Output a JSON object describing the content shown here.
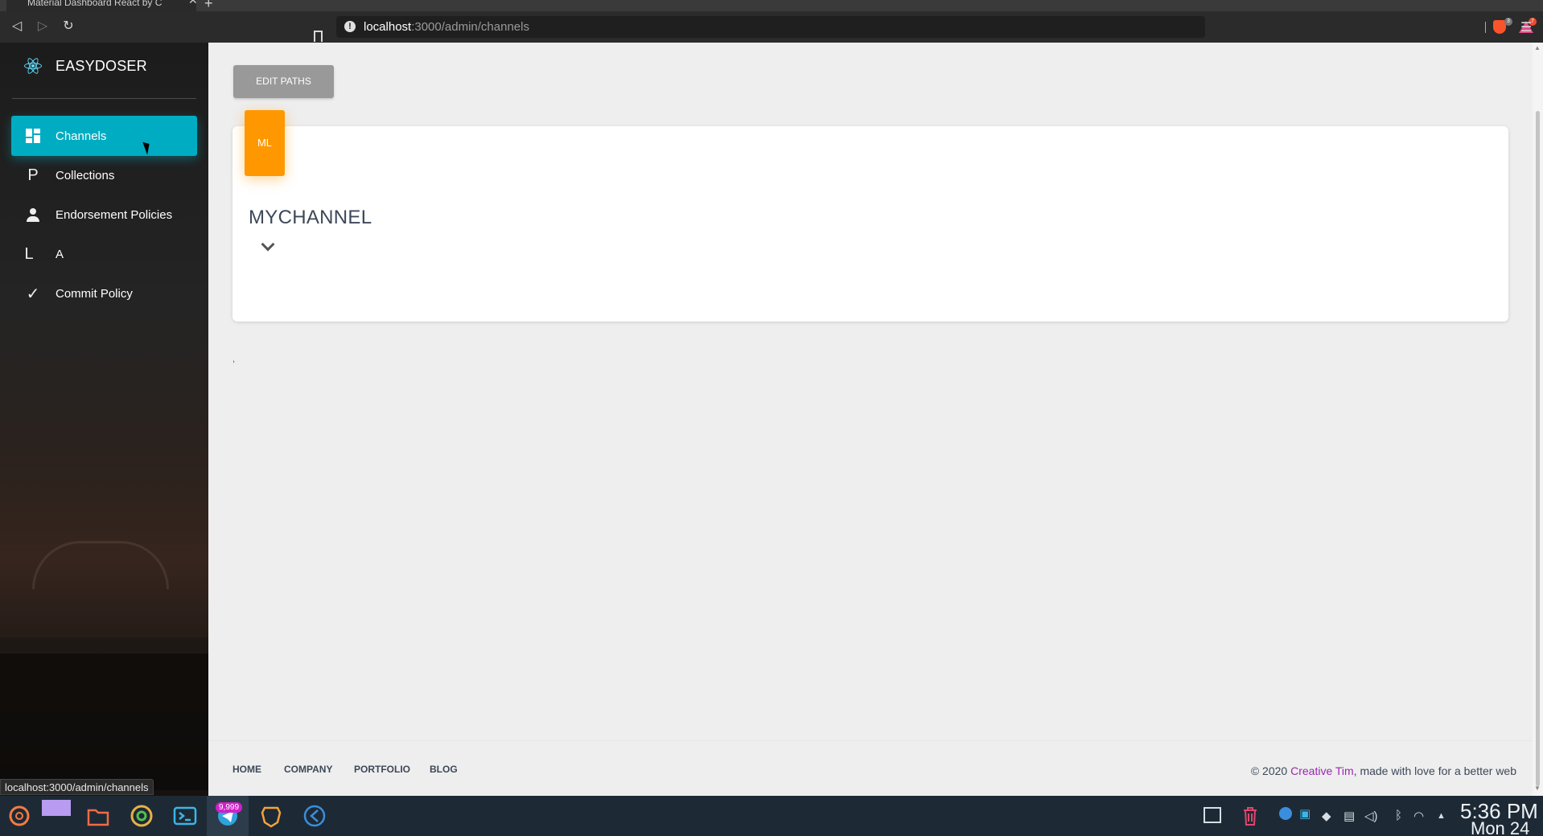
{
  "browser": {
    "tab_title": "Material Dashboard React by C",
    "tab_close": "✕",
    "new_tab": "+",
    "url_host": "localhost",
    "url_path": ":3000/admin/channels",
    "brave_badge": "3",
    "rewards_badge": "7",
    "status_url": "localhost:3000/admin/channels"
  },
  "sidebar": {
    "brand": "EASYDOSER",
    "items": [
      {
        "label": "Channels",
        "icon": "dashboard-icon",
        "active": true
      },
      {
        "label": "Collections",
        "icon_text": "P"
      },
      {
        "label": "Endorsement Policies",
        "icon": "person-icon"
      },
      {
        "label": "A",
        "icon_text": "L"
      },
      {
        "label": "Commit Policy",
        "icon": "check-icon",
        "icon_text": "✓"
      }
    ]
  },
  "main": {
    "edit_paths_label": "EDIT PATHS",
    "card": {
      "badge": "ML",
      "title": "MYCHANNEL",
      "expand_icon": "chevron-down-icon"
    },
    "stray_text": ","
  },
  "footer": {
    "links": [
      "HOME",
      "COMPANY",
      "PORTFOLIO",
      "BLOG"
    ],
    "copy_prefix": "© 2020 ",
    "copy_brand": "Creative Tim",
    "copy_suffix": ", made with love for a better web"
  },
  "taskbar": {
    "badge": "9,999",
    "time": "5:36 PM",
    "date": "Mon 24"
  },
  "colors": {
    "active_nav": "#00acc1",
    "badge_orange": "#ff9800",
    "edit_button": "#999999",
    "footer_brand": "#9c27b0"
  }
}
